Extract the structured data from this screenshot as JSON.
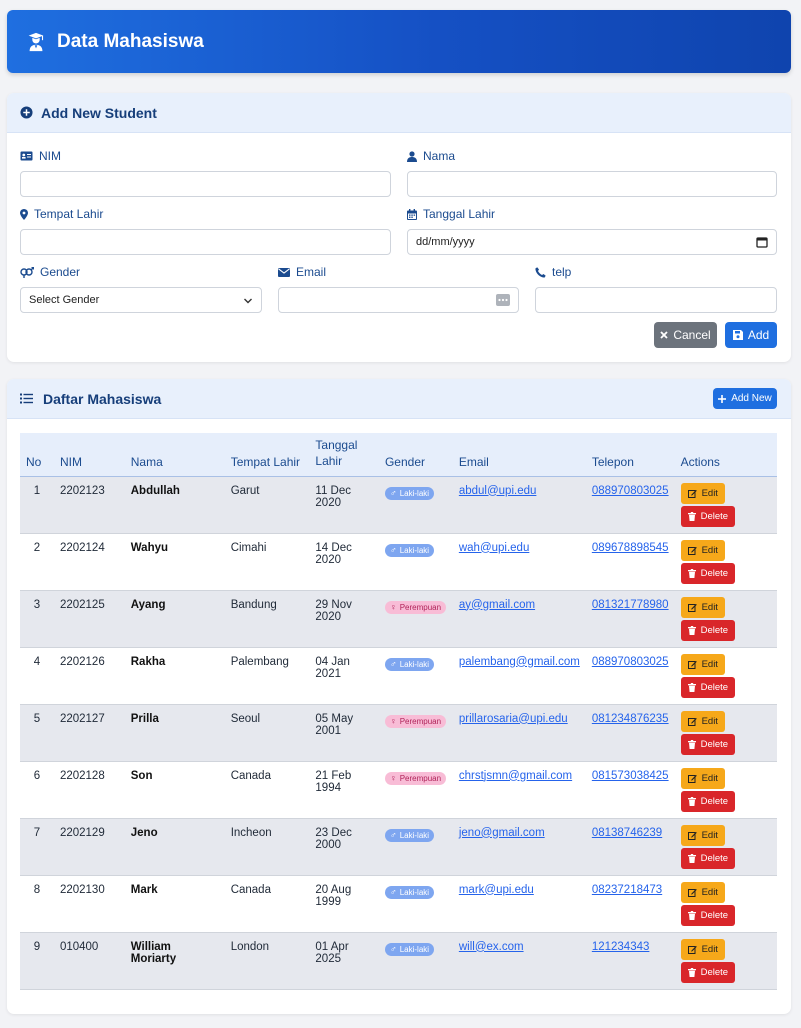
{
  "header": {
    "title": "Data Mahasiswa"
  },
  "form": {
    "title": "Add New Student",
    "nim_label": "NIM",
    "nama_label": "Nama",
    "tempat_label": "Tempat Lahir",
    "tanggal_label": "Tanggal Lahir",
    "tanggal_placeholder": "dd/mm/yyyy",
    "gender_label": "Gender",
    "gender_selected": "Select Gender",
    "email_label": "Email",
    "telp_label": "telp",
    "cancel_label": "Cancel",
    "add_label": "Add"
  },
  "list": {
    "title": "Daftar Mahasiswa",
    "add_new_label": "Add New",
    "columns": [
      "No",
      "NIM",
      "Nama",
      "Tempat Lahir",
      "Tanggal Lahir",
      "Gender",
      "Email",
      "Telepon",
      "Actions"
    ],
    "edit_label": "Edit",
    "delete_label": "Delete",
    "rows": [
      {
        "no": "1",
        "nim": "2202123",
        "nama": "Abdullah",
        "tempat": "Garut",
        "tanggal": "11 Dec 2020",
        "gender": "Laki-laki",
        "email": "abdul@upi.edu",
        "telp": "088970803025"
      },
      {
        "no": "2",
        "nim": "2202124",
        "nama": "Wahyu",
        "tempat": "Cimahi",
        "tanggal": "14 Dec 2020",
        "gender": "Laki-laki",
        "email": "wah@upi.edu",
        "telp": "089678898545"
      },
      {
        "no": "3",
        "nim": "2202125",
        "nama": "Ayang",
        "tempat": "Bandung",
        "tanggal": "29 Nov 2020",
        "gender": "Perempuan",
        "email": "ay@gmail.com",
        "telp": "081321778980"
      },
      {
        "no": "4",
        "nim": "2202126",
        "nama": "Rakha",
        "tempat": "Palembang",
        "tanggal": "04 Jan 2021",
        "gender": "Laki-laki",
        "email": "palembang@gmail.com",
        "telp": "088970803025"
      },
      {
        "no": "5",
        "nim": "2202127",
        "nama": "Prilla",
        "tempat": "Seoul",
        "tanggal": "05 May 2001",
        "gender": "Perempuan",
        "email": "prillarosaria@upi.edu",
        "telp": "081234876235"
      },
      {
        "no": "6",
        "nim": "2202128",
        "nama": "Son",
        "tempat": "Canada",
        "tanggal": "21 Feb 1994",
        "gender": "Perempuan",
        "email": "chrstjsmn@gmail.com",
        "telp": "081573038425"
      },
      {
        "no": "7",
        "nim": "2202129",
        "nama": "Jeno",
        "tempat": "Incheon",
        "tanggal": "23 Dec 2000",
        "gender": "Laki-laki",
        "email": "jeno@gmail.com",
        "telp": "08138746239"
      },
      {
        "no": "8",
        "nim": "2202130",
        "nama": "Mark",
        "tempat": "Canada",
        "tanggal": "20 Aug 1999",
        "gender": "Laki-laki",
        "email": "mark@upi.edu",
        "telp": "08237218473"
      },
      {
        "no": "9",
        "nim": "010400",
        "nama": "William Moriarty",
        "tempat": "London",
        "tanggal": "01 Apr 2025",
        "gender": "Laki-laki",
        "email": "will@ex.com",
        "telp": "121234343"
      }
    ]
  }
}
